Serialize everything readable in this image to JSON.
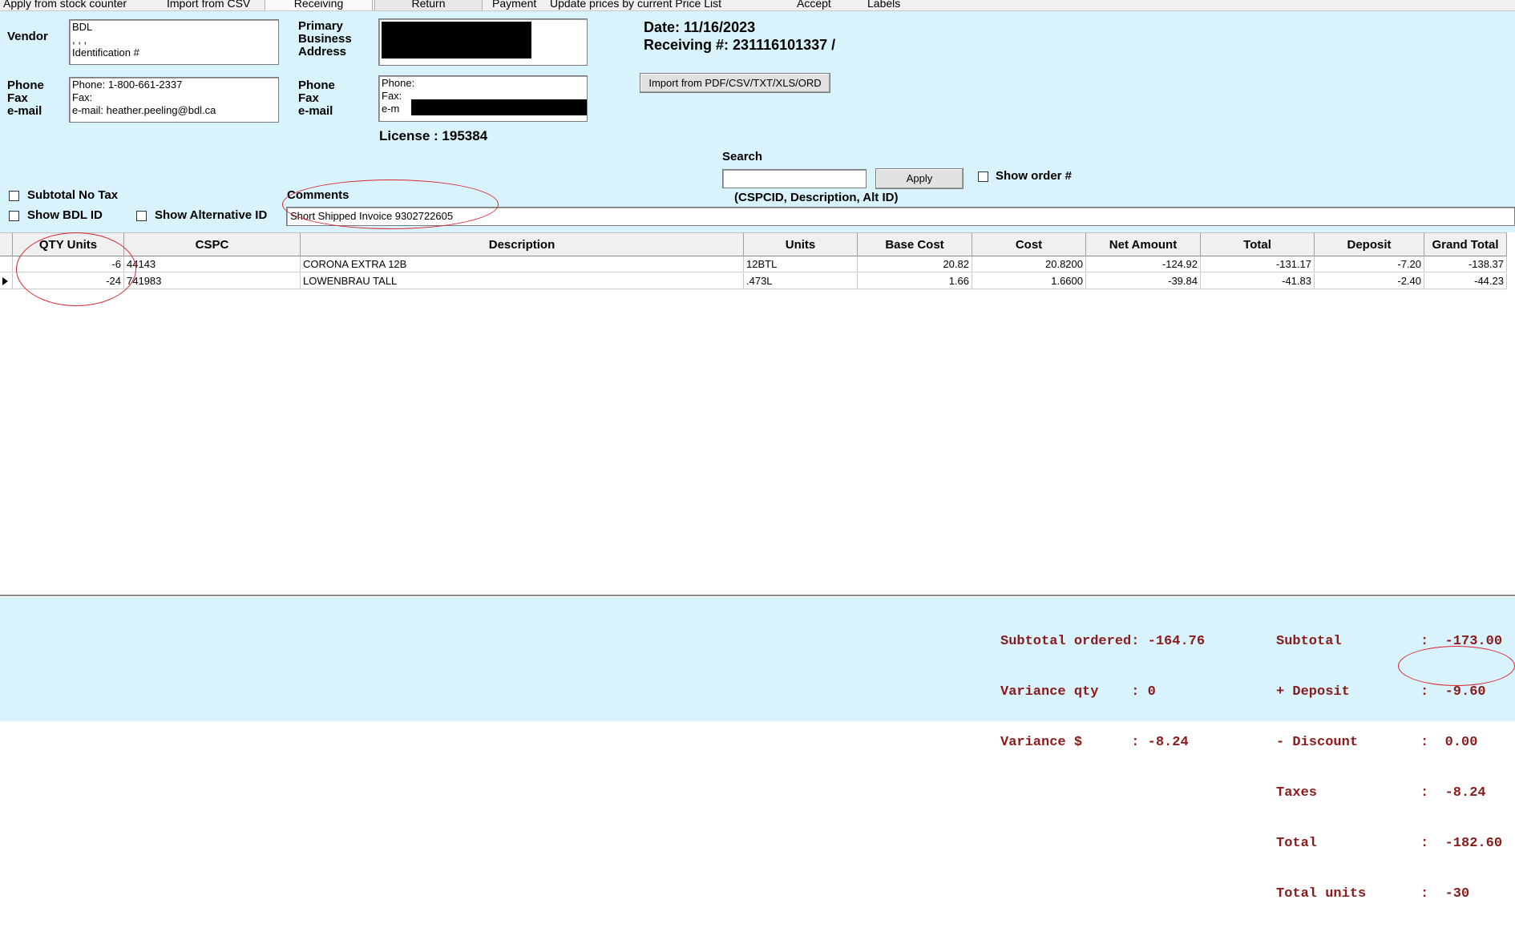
{
  "toolbar": {
    "items": [
      "Apply from stock counter",
      "Import from CSV",
      "Receiving",
      "Return",
      "Payment",
      "Update prices by current Price List",
      "Accept",
      "Labels"
    ]
  },
  "vendor": {
    "label": "Vendor",
    "lines": [
      "BDL",
      ", , ,",
      "Identification #"
    ]
  },
  "vendor_contact": {
    "label_lines": [
      "Phone",
      "Fax",
      "e-mail"
    ],
    "lines": [
      "Phone: 1-800-661-2337",
      "Fax:",
      "e-mail: heather.peeling@bdl.ca"
    ]
  },
  "primary": {
    "label_lines": [
      "Primary",
      "Business",
      "Address"
    ]
  },
  "primary_contact": {
    "label_lines": [
      "Phone",
      "Fax",
      "e-mail"
    ],
    "lines": [
      "Phone:",
      "Fax:",
      "e-m"
    ]
  },
  "license": "License :  195384",
  "date": "Date: 11/16/2023",
  "receiving_no": "Receiving #: 231116101337 /",
  "import_button": "Import from PDF/CSV/TXT/XLS/ORD",
  "search": {
    "label": "Search",
    "value": "",
    "apply_label": "Apply",
    "hint": "(CSPCID, Description, Alt ID)",
    "show_order_label": "Show order #"
  },
  "options": {
    "subtotal_no_tax": "Subtotal No Tax",
    "show_bdl_id": "Show BDL ID",
    "show_alt_id": "Show Alternative ID"
  },
  "comments": {
    "label": "Comments",
    "value": "Short Shipped Invoice 9302722605"
  },
  "grid": {
    "columns": [
      "QTY Units",
      "CSPC",
      "Description",
      "Units",
      "Base Cost",
      "Cost",
      "Net Amount",
      "Total",
      "Deposit",
      "Grand Total"
    ],
    "rows": [
      {
        "qty": "-6",
        "cspc": "44143",
        "description": "CORONA EXTRA 12B",
        "units": "12BTL",
        "base_cost": "20.82",
        "cost": "20.8200",
        "net_amount": "-124.92",
        "total": "-131.17",
        "deposit": "-7.20",
        "grand_total": "-138.37"
      },
      {
        "qty": "-24",
        "cspc": "741983",
        "description": "LOWENBRAU TALL",
        "units": ".473L",
        "base_cost": "1.66",
        "cost": "1.6600",
        "net_amount": "-39.84",
        "total": "-41.83",
        "deposit": "-2.40",
        "grand_total": "-44.23"
      }
    ]
  },
  "summary_left": [
    {
      "label": "Subtotal ordered",
      "sep": ": ",
      "value": "-164.76"
    },
    {
      "label": "Variance qty    ",
      "sep": ": ",
      "value": "0"
    },
    {
      "label": "Variance $      ",
      "sep": ": ",
      "value": "-8.24"
    }
  ],
  "summary_right": [
    {
      "label": "Subtotal",
      "value": ":  -173.00"
    },
    {
      "label": "+ Deposit",
      "value": ":  -9.60"
    },
    {
      "label": "- Discount",
      "value": ":  0.00"
    },
    {
      "label": "Taxes",
      "value": ":  -8.24"
    },
    {
      "label": "Total",
      "value": ":  -182.60"
    },
    {
      "label": "Total units",
      "value": ":  -30"
    }
  ],
  "colors": {
    "panel": "#d9f3fc",
    "totals_text": "#8b1a1a",
    "annotation": "#d9232e"
  }
}
